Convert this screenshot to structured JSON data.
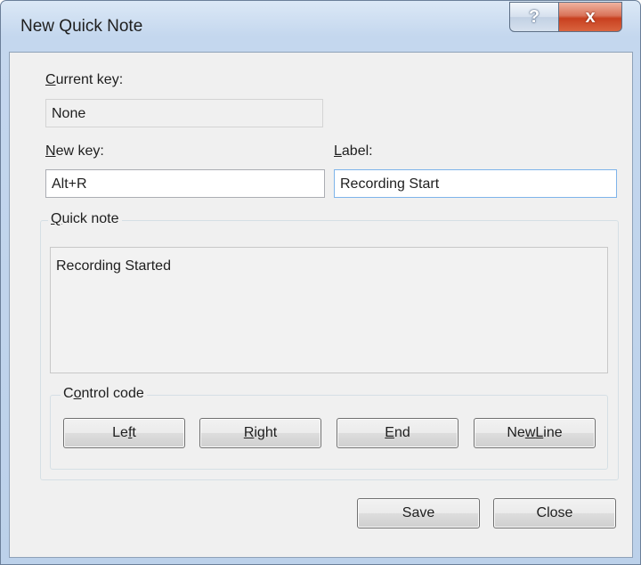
{
  "window": {
    "title": "New Quick Note",
    "help_glyph": "?",
    "close_glyph": "x"
  },
  "current_key": {
    "label_mnemonic": "C",
    "label_rest": "urrent key:",
    "value": "None"
  },
  "new_key": {
    "label_mnemonic": "N",
    "label_rest": "ew key:",
    "value": "Alt+R"
  },
  "label_field": {
    "label_mnemonic": "L",
    "label_rest": "abel:",
    "value": "Recording Start"
  },
  "quick_note": {
    "legend_mnemonic": "Q",
    "legend_rest": "uick note",
    "text": "Recording Started"
  },
  "control_code": {
    "legend_pre": "C",
    "legend_mnemonic": "o",
    "legend_rest": "ntrol code",
    "buttons": [
      {
        "pre": "Le",
        "mnemonic": "f",
        "post": "t"
      },
      {
        "pre": "",
        "mnemonic": "R",
        "post": "ight"
      },
      {
        "pre": "",
        "mnemonic": "E",
        "post": "nd"
      },
      {
        "pre": "Ne",
        "mnemonic": "w",
        "post": " Line",
        "post_mnemonic_underline": "L"
      }
    ]
  },
  "footer": {
    "save_label": "Save",
    "close_label": "Close"
  },
  "colors": {
    "title_bar": "#c4d7ee",
    "client_bg": "#f0f0f0",
    "close_button": "#c8401f",
    "focus_border": "#7eb4ea"
  }
}
